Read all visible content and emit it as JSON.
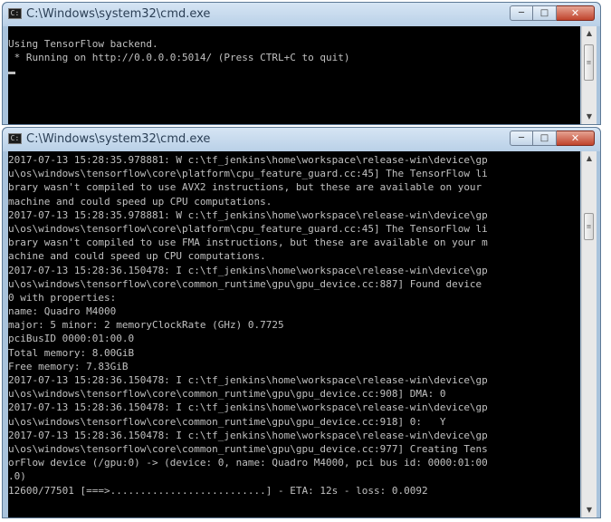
{
  "windows": [
    {
      "title": "C:\\Windows\\system32\\cmd.exe",
      "lines": [
        "Using TensorFlow backend.",
        " * Running on http://0.0.0.0:5014/ (Press CTRL+C to quit)"
      ]
    },
    {
      "title": "C:\\Windows\\system32\\cmd.exe",
      "lines": [
        "2017-07-13 15:28:35.978881: W c:\\tf_jenkins\\home\\workspace\\release-win\\device\\gp",
        "u\\os\\windows\\tensorflow\\core\\platform\\cpu_feature_guard.cc:45] The TensorFlow li",
        "brary wasn't compiled to use AVX2 instructions, but these are available on your",
        "machine and could speed up CPU computations.",
        "2017-07-13 15:28:35.978881: W c:\\tf_jenkins\\home\\workspace\\release-win\\device\\gp",
        "u\\os\\windows\\tensorflow\\core\\platform\\cpu_feature_guard.cc:45] The TensorFlow li",
        "brary wasn't compiled to use FMA instructions, but these are available on your m",
        "achine and could speed up CPU computations.",
        "2017-07-13 15:28:36.150478: I c:\\tf_jenkins\\home\\workspace\\release-win\\device\\gp",
        "u\\os\\windows\\tensorflow\\core\\common_runtime\\gpu\\gpu_device.cc:887] Found device",
        "0 with properties:",
        "name: Quadro M4000",
        "major: 5 minor: 2 memoryClockRate (GHz) 0.7725",
        "pciBusID 0000:01:00.0",
        "Total memory: 8.00GiB",
        "Free memory: 7.83GiB",
        "2017-07-13 15:28:36.150478: I c:\\tf_jenkins\\home\\workspace\\release-win\\device\\gp",
        "u\\os\\windows\\tensorflow\\core\\common_runtime\\gpu\\gpu_device.cc:908] DMA: 0",
        "2017-07-13 15:28:36.150478: I c:\\tf_jenkins\\home\\workspace\\release-win\\device\\gp",
        "u\\os\\windows\\tensorflow\\core\\common_runtime\\gpu\\gpu_device.cc:918] 0:   Y",
        "2017-07-13 15:28:36.150478: I c:\\tf_jenkins\\home\\workspace\\release-win\\device\\gp",
        "u\\os\\windows\\tensorflow\\core\\common_runtime\\gpu\\gpu_device.cc:977] Creating Tens",
        "orFlow device (/gpu:0) -> (device: 0, name: Quadro M4000, pci bus id: 0000:01:00",
        ".0)",
        "12600/77501 [===>..........................] - ETA: 12s - loss: 0.0092"
      ]
    }
  ],
  "colors": {
    "console_bg": "#000000",
    "console_text": "#c0c0c0",
    "close_button": "#c0432c"
  },
  "icons": {
    "app": "cmd-icon",
    "minimize": "minimize-icon",
    "maximize": "maximize-icon",
    "close": "close-icon"
  }
}
